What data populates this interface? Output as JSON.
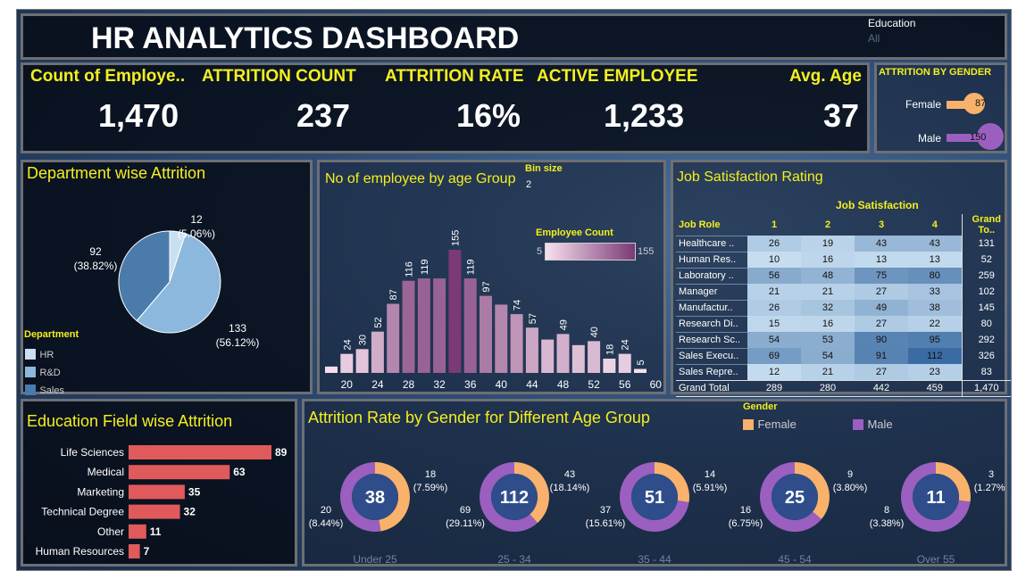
{
  "header": {
    "title": "HR ANALYTICS DASHBOARD",
    "filter_label": "Education",
    "filter_value": "All"
  },
  "kpis": [
    {
      "label": "Count of Employe..",
      "value": "1,470"
    },
    {
      "label": "ATTRITION COUNT",
      "value": "237"
    },
    {
      "label": "ATTRITION RATE",
      "value": "16%"
    },
    {
      "label": "ACTIVE EMPLOYEE",
      "value": "1,233"
    },
    {
      "label": "Avg. Age",
      "value": "37"
    }
  ],
  "gender_attrition": {
    "title": "ATTRITION BY GENDER",
    "rows": [
      {
        "label": "Female",
        "value": "87",
        "color": "#f9b26b"
      },
      {
        "label": "Male",
        "value": "150",
        "color": "#9b5fc0"
      }
    ]
  },
  "department": {
    "title": "Department wise Attrition",
    "legend_title": "Department",
    "legend": [
      {
        "label": "HR",
        "color": "#c9dff2"
      },
      {
        "label": "R&D",
        "color": "#8cb8de"
      },
      {
        "label": "Sales",
        "color": "#4a7bab"
      }
    ],
    "labels": [
      {
        "count": "12",
        "pct": "(5.06%)"
      },
      {
        "count": "133",
        "pct": "(56.12%)"
      },
      {
        "count": "92",
        "pct": "(38.82%)"
      }
    ]
  },
  "age_group": {
    "title": "No of employee by age Group",
    "bin_label": "Bin size",
    "bin_value": "2",
    "legend_title": "Employee Count",
    "legend_min": "5",
    "legend_max": "155"
  },
  "job_satisfaction": {
    "title": "Job Satisfaction Rating",
    "super_header": "Job Satisfaction",
    "headers": [
      "Job Role",
      "1",
      "2",
      "3",
      "4",
      "Grand To.."
    ],
    "rows": [
      {
        "role": "Healthcare ..",
        "v": [
          "26",
          "19",
          "43",
          "43"
        ],
        "total": "131"
      },
      {
        "role": "Human Res..",
        "v": [
          "10",
          "16",
          "13",
          "13"
        ],
        "total": "52"
      },
      {
        "role": "Laboratory ..",
        "v": [
          "56",
          "48",
          "75",
          "80"
        ],
        "total": "259"
      },
      {
        "role": "Manager",
        "v": [
          "21",
          "21",
          "27",
          "33"
        ],
        "total": "102"
      },
      {
        "role": "Manufactur..",
        "v": [
          "26",
          "32",
          "49",
          "38"
        ],
        "total": "145"
      },
      {
        "role": "Research Di..",
        "v": [
          "15",
          "16",
          "27",
          "22"
        ],
        "total": "80"
      },
      {
        "role": "Research Sc..",
        "v": [
          "54",
          "53",
          "90",
          "95"
        ],
        "total": "292"
      },
      {
        "role": "Sales Execu..",
        "v": [
          "69",
          "54",
          "91",
          "112"
        ],
        "total": "326"
      },
      {
        "role": "Sales Repre..",
        "v": [
          "12",
          "21",
          "27",
          "23"
        ],
        "total": "83"
      }
    ],
    "grand": {
      "role": "Grand Total",
      "v": [
        "289",
        "280",
        "442",
        "459"
      ],
      "total": "1,470"
    }
  },
  "education": {
    "title": "Education Field wise Attrition"
  },
  "gender_age": {
    "title": "Attrition Rate by Gender for Different Age Group",
    "legend_title": "Gender",
    "legend": [
      {
        "label": "Female",
        "color": "#f9b26b"
      },
      {
        "label": "Male",
        "color": "#9b5fc0"
      }
    ],
    "groups": [
      {
        "name": "Under 25",
        "total": "38",
        "female": "18",
        "female_pct": "(7.59%)",
        "male": "20",
        "male_pct": "(8.44%)"
      },
      {
        "name": "25 - 34",
        "total": "112",
        "female": "43",
        "female_pct": "(18.14%)",
        "male": "69",
        "male_pct": "(29.11%)"
      },
      {
        "name": "35 - 44",
        "total": "51",
        "female": "14",
        "female_pct": "(5.91%)",
        "male": "37",
        "male_pct": "(15.61%)"
      },
      {
        "name": "45 - 54",
        "total": "25",
        "female": "9",
        "female_pct": "(3.80%)",
        "male": "16",
        "male_pct": "(6.75%)"
      },
      {
        "name": "Over 55",
        "total": "11",
        "female": "3",
        "female_pct": "(1.27%)",
        "male": "8",
        "male_pct": "(3.38%)"
      }
    ]
  },
  "chart_data": [
    {
      "type": "pie",
      "title": "Department wise Attrition",
      "categories": [
        "HR",
        "R&D",
        "Sales"
      ],
      "values": [
        12,
        133,
        92
      ],
      "percent": [
        5.06,
        56.12,
        38.82
      ],
      "colors": [
        "#c9dff2",
        "#8cb8de",
        "#4a7bab"
      ]
    },
    {
      "type": "bar",
      "title": "No of employee by age Group",
      "x": [
        18,
        20,
        22,
        24,
        26,
        28,
        30,
        32,
        34,
        36,
        38,
        40,
        42,
        44,
        46,
        48,
        50,
        52,
        54,
        56,
        58,
        60
      ],
      "xticks": [
        "20",
        "24",
        "28",
        "32",
        "36",
        "40",
        "44",
        "48",
        "52",
        "56",
        "60"
      ],
      "values": [
        8,
        24,
        30,
        52,
        87,
        116,
        119,
        119,
        155,
        119,
        97,
        86,
        74,
        57,
        42,
        49,
        35,
        40,
        18,
        24,
        5,
        0
      ],
      "value_labels": [
        null,
        "24",
        "30",
        "52",
        "87",
        "116",
        "119",
        null,
        "155",
        "119",
        "97",
        null,
        "74",
        "57",
        null,
        "49",
        null,
        "40",
        "18",
        "24",
        "5",
        null
      ],
      "color_scale": {
        "min": 5,
        "max": 155,
        "from": "#f7e1ee",
        "to": "#7a3a77"
      }
    },
    {
      "type": "bar",
      "orientation": "horizontal",
      "title": "Education Field wise Attrition",
      "categories": [
        "Life Sciences",
        "Medical",
        "Marketing",
        "Technical Degree",
        "Other",
        "Human Resources"
      ],
      "values": [
        89,
        63,
        35,
        32,
        11,
        7
      ],
      "color": "#e05a5c"
    },
    {
      "type": "pie",
      "title": "Attrition Rate by Gender for Different Age Group",
      "categories": [
        "Under 25",
        "25 - 34",
        "35 - 44",
        "45 - 54",
        "Over 55"
      ],
      "series": [
        {
          "name": "Female",
          "values": [
            18,
            43,
            14,
            9,
            3
          ]
        },
        {
          "name": "Male",
          "values": [
            20,
            69,
            37,
            16,
            8
          ]
        }
      ],
      "totals": [
        38,
        112,
        51,
        25,
        11
      ]
    }
  ]
}
